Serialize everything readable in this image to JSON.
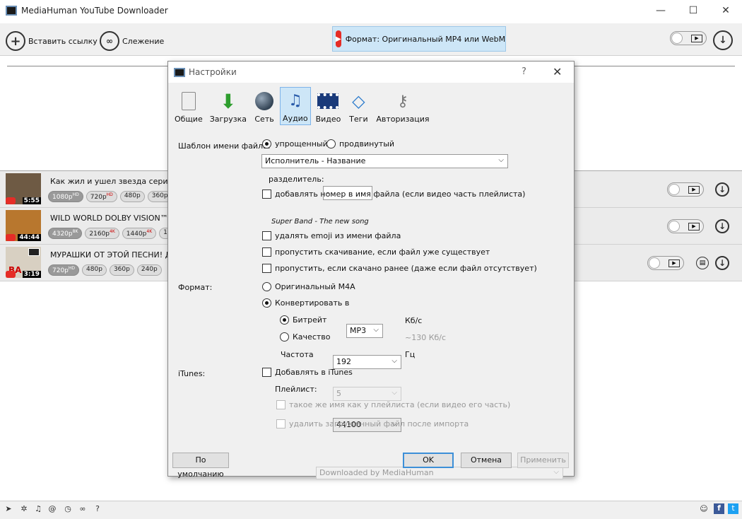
{
  "window": {
    "title": "MediaHuman YouTube Downloader",
    "min": "—",
    "max": "☐",
    "close": "✕"
  },
  "toolbar": {
    "paste_link": "Вставить ссылку",
    "tracking": "Слежение",
    "format": "Формат: Оригинальный MP4 или WebM"
  },
  "videos": [
    {
      "title": "Как жил и ушел звезда сериала",
      "duration": "5:55",
      "qualities": [
        {
          "label": "1080p",
          "sup": "HD",
          "selected": true
        },
        {
          "label": "720p",
          "sup": "HD"
        },
        {
          "label": "480p"
        },
        {
          "label": "360p"
        }
      ],
      "thumb_color": "#7a6a52"
    },
    {
      "title": "WILD WORLD DOLBY VISION™ | E",
      "duration": "44:44",
      "qualities": [
        {
          "label": "4320p",
          "sup": "8K",
          "selected": true
        },
        {
          "label": "2160p",
          "sup": "4K"
        },
        {
          "label": "1440p",
          "sup": "4K"
        },
        {
          "label": "1"
        }
      ],
      "thumb_color": "#b8772e"
    },
    {
      "title": "МУРАШКИ ОТ ЭТОЙ ПЕСНИ! ДУШ",
      "duration": "3:19",
      "qualities": [
        {
          "label": "720p",
          "sup": "HD",
          "selected": true
        },
        {
          "label": "480p"
        },
        {
          "label": "360p"
        },
        {
          "label": "240p"
        }
      ],
      "thumb_color": "#c9c0b0",
      "thumb_text": "ВА"
    }
  ],
  "dialog": {
    "title": "Настройки",
    "help": "?",
    "close": "✕",
    "tabs": [
      {
        "label": "Общие",
        "icon": "phone-icon"
      },
      {
        "label": "Загрузка",
        "icon": "download-arrow-icon"
      },
      {
        "label": "Сеть",
        "icon": "globe-icon"
      },
      {
        "label": "Аудио",
        "icon": "music-note-icon",
        "active": true
      },
      {
        "label": "Видео",
        "icon": "film-icon"
      },
      {
        "label": "Теги",
        "icon": "tag-icon"
      },
      {
        "label": "Авторизация",
        "icon": "keys-icon"
      }
    ],
    "filename_label": "Шаблон имени файла:",
    "simple": "упрощенный",
    "advanced": "продвинутый",
    "template_value": "Исполнитель - Название",
    "separator_label": "разделитель:",
    "separator_value": "-",
    "add_number": "добавлять номер в имя файла (если видео часть плейлиста)",
    "example": "Super Band - The new song",
    "remove_emoji": "удалять emoji из имени файла",
    "skip_exists": "пропустить скачивание, если файл уже существует",
    "skip_downloaded": "пропустить, если скачано ранее (даже если файл отсутствует)",
    "format_label": "Формат:",
    "original_m4a": "Оригинальный M4A",
    "convert_to": "Конвертировать в",
    "convert_value": "MP3",
    "bitrate_label": "Битрейт",
    "bitrate_value": "192",
    "bitrate_unit": "Кб/с",
    "quality_label": "Качество",
    "quality_value": "5",
    "quality_unit": "~130 Кб/с",
    "freq_label": "Частота",
    "freq_value": "44100",
    "freq_unit": "Гц",
    "itunes_label": "iTunes:",
    "add_itunes": "Добавлять в iTunes",
    "playlist_label": "Плейлист:",
    "playlist_value": "Downloaded by MediaHuman",
    "same_name": "такое же имя как у плейлиста (если видео его часть)",
    "delete_after": "удалить загруженный файл после импорта",
    "default_btn": "По умолчанию",
    "ok_btn": "OK",
    "cancel_btn": "Отмена",
    "apply_btn": "Применить"
  }
}
